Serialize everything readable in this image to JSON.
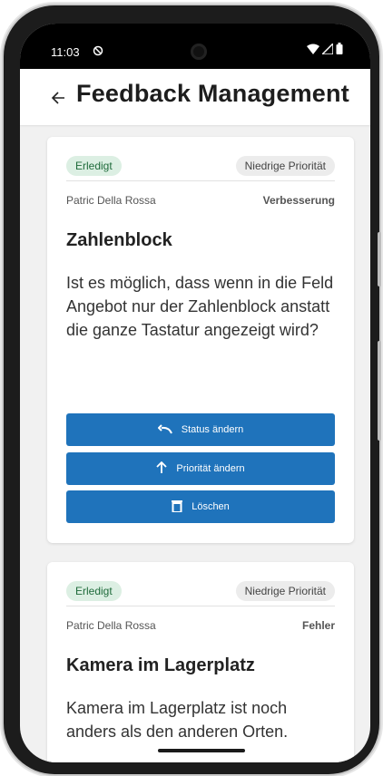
{
  "statusbar": {
    "time": "11:03"
  },
  "appbar": {
    "title": "Feedback Management"
  },
  "cards": [
    {
      "status": "Erledigt",
      "priority": "Niedrige Priorität",
      "author": "Patric Della Rossa",
      "type": "Verbesserung",
      "title": "Zahlenblock",
      "text": "Ist es möglich, dass wenn in die Feld Angebot nur der Zahlenblock anstatt die ganze Tastatur angezeigt wird?",
      "buttons": {
        "status": "Status ändern",
        "priority": "Priorität ändern",
        "delete": "Löschen"
      }
    },
    {
      "status": "Erledigt",
      "priority": "Niedrige Priorität",
      "author": "Patric Della Rossa",
      "type": "Fehler",
      "title": "Kamera im Lagerplatz",
      "text": "Kamera im Lagerplatz ist noch anders als den anderen Orten."
    }
  ],
  "colors": {
    "primary": "#1f73bb",
    "status_chip_bg": "#dcefe3",
    "status_chip_text": "#1f6b3b"
  }
}
